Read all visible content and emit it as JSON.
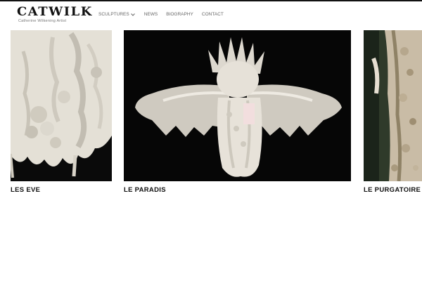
{
  "header": {
    "logo_text": "CATWILK",
    "logo_subtitle": "Catherine Wilkening Artist"
  },
  "nav": {
    "items": [
      {
        "label": "SCULPTURES",
        "has_dropdown": true
      },
      {
        "label": "NEWS"
      },
      {
        "label": "BIOGRAPHY"
      },
      {
        "label": "CONTACT"
      }
    ]
  },
  "gallery": {
    "items": [
      {
        "title": "LES EVE",
        "image": "white ceramic sculpture close-up"
      },
      {
        "title": "LE PARADIS",
        "image": "white winged angel sculpture on black"
      },
      {
        "title": "LE PURGATOIRE",
        "image": "ceramic figure with shell texture"
      }
    ]
  },
  "colors": {
    "text": "#111111",
    "nav": "#666666",
    "image_bg": "#000000",
    "ceramic": "#e6e2da"
  }
}
